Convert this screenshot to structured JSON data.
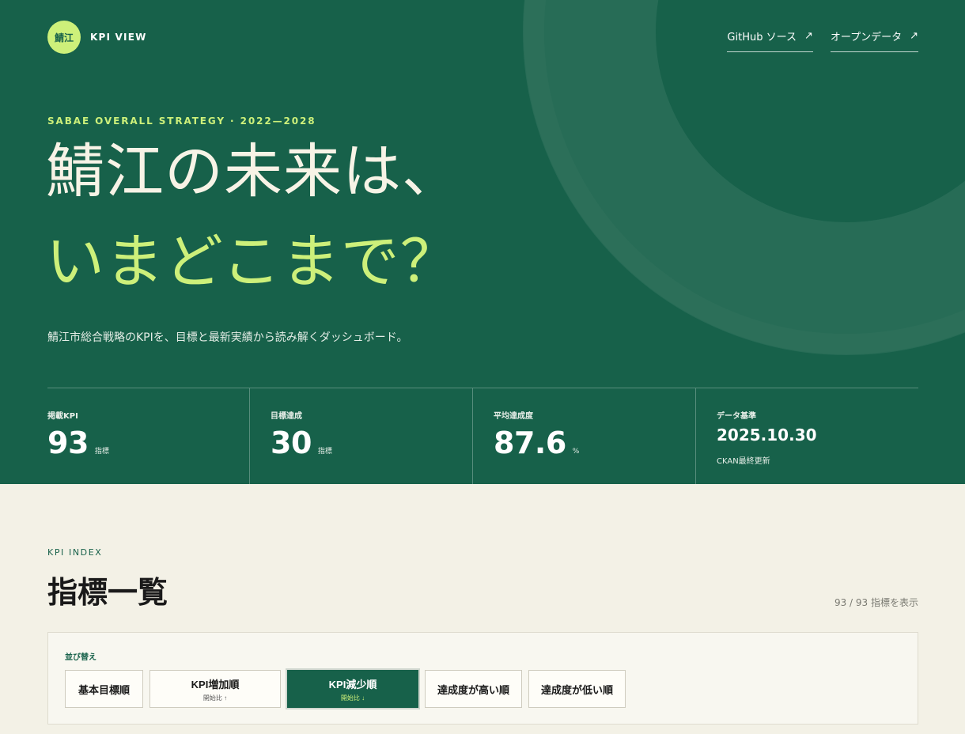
{
  "brand": {
    "logo_text": "鯖江",
    "name": "KPI VIEW"
  },
  "header": {
    "links": [
      {
        "label": "GitHub ソース",
        "icon": "↗"
      },
      {
        "label": "オープンデータ",
        "icon": "↗"
      }
    ]
  },
  "hero": {
    "eyebrow": "SABAE OVERALL STRATEGY · 2022—2028",
    "title_line1": "鯖江の未来は、",
    "title_line2": "いまどこまで？",
    "lead": "鯖江市総合戦略のKPIを、目標と最新実績から読み解くダッシュボード。"
  },
  "stats": [
    {
      "label": "掲載KPI",
      "value": "93",
      "unit": "指標"
    },
    {
      "label": "目標達成",
      "value": "30",
      "unit": "指標"
    },
    {
      "label": "平均達成度",
      "value": "87.6",
      "unit": "%"
    },
    {
      "label": "データ基準",
      "value": "2025.10.30",
      "sub": "CKAN最終更新"
    }
  ],
  "index": {
    "kicker": "KPI INDEX",
    "title": "指標一覧",
    "count": "93 / 93 指標を表示"
  },
  "sort": {
    "label": "並び替え",
    "options": [
      {
        "label": "基本目標順",
        "sub": ""
      },
      {
        "label": "KPI増加順",
        "sub": "開始比 ↑"
      },
      {
        "label": "KPI減少順",
        "sub": "開始比 ↓"
      },
      {
        "label": "達成度が高い順",
        "sub": ""
      },
      {
        "label": "達成度が低い順",
        "sub": ""
      }
    ],
    "active_label": "KPI減少順"
  },
  "colors": {
    "hero_bg": "#17614a",
    "accent": "#cdf07a",
    "page_bg": "#f3f1e6"
  }
}
